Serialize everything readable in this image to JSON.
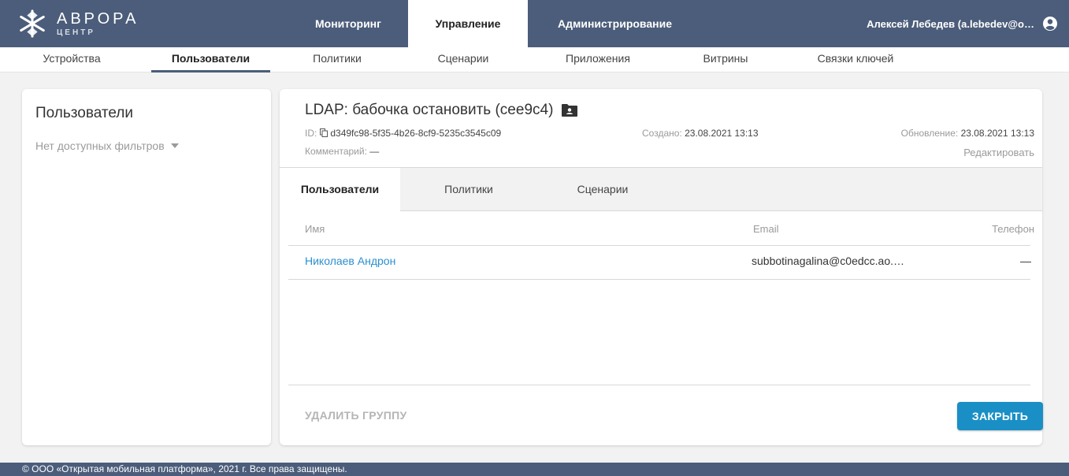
{
  "brand": {
    "title": "АВРОРА",
    "subtitle": "ЦЕНТР"
  },
  "main_tabs": [
    {
      "label": "Мониторинг",
      "active": false
    },
    {
      "label": "Управление",
      "active": true
    },
    {
      "label": "Администрирование",
      "active": false
    }
  ],
  "user": {
    "name": "Алексей Лебедев (a.lebedev@o…",
    "icon": "account-circle-icon"
  },
  "sub_nav": [
    {
      "label": "Устройства",
      "active": false
    },
    {
      "label": "Пользователи",
      "active": true
    },
    {
      "label": "Политики",
      "active": false
    },
    {
      "label": "Сценарии",
      "active": false
    },
    {
      "label": "Приложения",
      "active": false
    },
    {
      "label": "Витрины",
      "active": false
    },
    {
      "label": "Связки ключей",
      "active": false
    }
  ],
  "left_panel": {
    "title": "Пользователи",
    "filter_text": "Нет доступных фильтров"
  },
  "group": {
    "title": "LDAP: бабочка остановить (cee9c4)",
    "id_label": "ID:",
    "id_value": "d349fc98-5f35-4b26-8cf9-5235c3545c09",
    "comment_label": "Комментарий:",
    "comment_value": "—",
    "created_label": "Создано:",
    "created_value": "23.08.2021 13:13",
    "updated_label": "Обновление:",
    "updated_value": "23.08.2021 13:13",
    "edit_label": "Редактировать"
  },
  "detail_tabs": [
    {
      "label": "Пользователи",
      "active": true
    },
    {
      "label": "Политики",
      "active": false
    },
    {
      "label": "Сценарии",
      "active": false
    }
  ],
  "table": {
    "columns": [
      "Имя",
      "Email",
      "Телефон"
    ],
    "rows": [
      {
        "name": "Николаев Андрон",
        "email": "subbotinagalina@c0edcc.ao.…",
        "phone": "—"
      }
    ]
  },
  "actions": {
    "delete_label": "УДАЛИТЬ ГРУППУ",
    "close_label": "ЗАКРЫТЬ"
  },
  "footer": {
    "text": "© ООО «Открытая мобильная платформа», 2021 г. Все права защищены."
  },
  "colors": {
    "header_bg": "#4b5d7a",
    "accent": "#1a8fc6",
    "link": "#2a8fcf"
  }
}
